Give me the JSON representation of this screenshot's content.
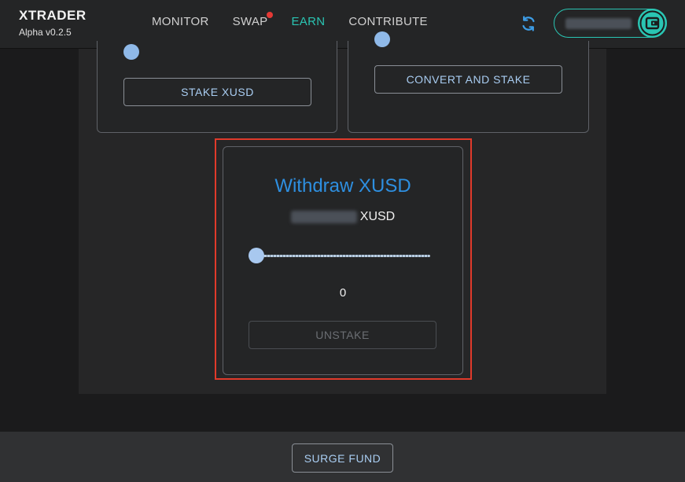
{
  "header": {
    "brand": "XTRADER",
    "version": "Alpha v0.2.5",
    "nav": [
      {
        "label": "MONITOR",
        "active": false,
        "notification": false
      },
      {
        "label": "SWAP",
        "active": false,
        "notification": true
      },
      {
        "label": "EARN",
        "active": true,
        "notification": false
      },
      {
        "label": "CONTRIBUTE",
        "active": false,
        "notification": false
      }
    ],
    "refresh_icon": "refresh-icon",
    "wallet_icon": "wallet-icon"
  },
  "cards": {
    "stake_xusd_label": "STAKE XUSD",
    "convert_stake_label": "CONVERT AND STAKE"
  },
  "withdraw": {
    "title": "Withdraw XUSD",
    "unit": "XUSD",
    "slider_value": "0",
    "slider_fraction": 0,
    "unstake_label": "UNSTAKE"
  },
  "footer": {
    "surge_fund_label": "SURGE FUND"
  },
  "colors": {
    "accent": "#2ac5b3",
    "title_blue": "#2e8fe0",
    "notification": "#e53935",
    "highlight": "#e03a2b"
  }
}
